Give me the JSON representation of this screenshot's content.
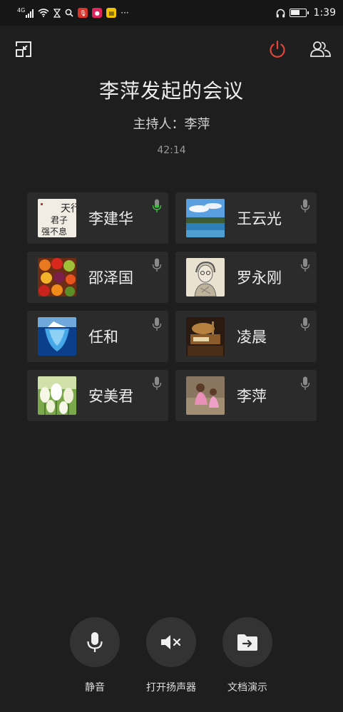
{
  "status_bar": {
    "network": "4G",
    "time": "1:39",
    "more": "···"
  },
  "meeting": {
    "title": "李萍发起的会议",
    "host": "主持人：李萍",
    "duration": "42:14"
  },
  "participants": [
    {
      "name": "李建华",
      "avatar": "calligraphy",
      "speaking": true
    },
    {
      "name": "王云光",
      "avatar": "lake-landscape",
      "speaking": false
    },
    {
      "name": "邵泽国",
      "avatar": "fruits",
      "speaking": false
    },
    {
      "name": "罗永刚",
      "avatar": "sketch-portrait",
      "speaking": false
    },
    {
      "name": "任和",
      "avatar": "iceberg",
      "speaking": false
    },
    {
      "name": "凌晨",
      "avatar": "desk-lamp",
      "speaking": false
    },
    {
      "name": "安美君",
      "avatar": "tulips",
      "speaking": false
    },
    {
      "name": "李萍",
      "avatar": "kids-playing",
      "speaking": false
    }
  ],
  "controls": {
    "mute": "静音",
    "speaker": "打开扬声器",
    "present": "文档演示"
  },
  "colors": {
    "background": "#1e1e1e",
    "card": "#2b2b2b",
    "end_call": "#e0463b",
    "speaking_mic": "#3fbf3f",
    "idle_mic": "#8a8a8a"
  }
}
